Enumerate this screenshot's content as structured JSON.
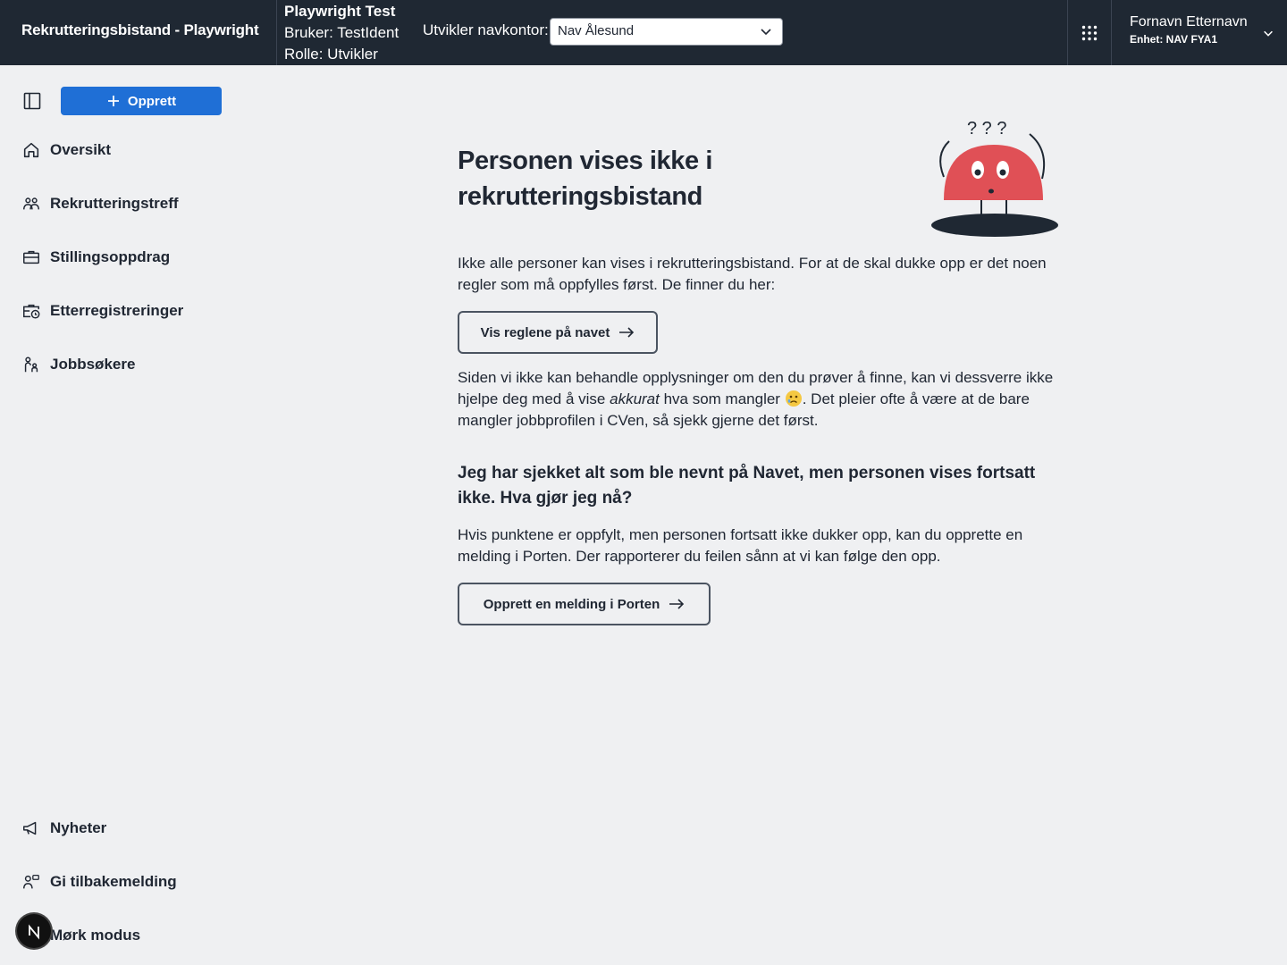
{
  "header": {
    "brand": "Rekrutteringsbistand - Playwright",
    "playwright_title": "Playwright Test",
    "user_line": "Bruker: TestIdent",
    "role_line": "Rolle: Utvikler",
    "kontor_label": "Utvikler navkontor:",
    "kontor_value": "Nav Ålesund",
    "user_name": "Fornavn Etternavn",
    "user_unit": "Enhet: NAV FYA1"
  },
  "sidebar": {
    "create_label": "Opprett",
    "items": [
      {
        "label": "Oversikt",
        "icon": "house-icon"
      },
      {
        "label": "Rekrutteringstreff",
        "icon": "people-icon"
      },
      {
        "label": "Stillingsoppdrag",
        "icon": "briefcase-icon"
      },
      {
        "label": "Etterregistreringer",
        "icon": "briefcase-clock-icon"
      },
      {
        "label": "Jobbsøkere",
        "icon": "person-group-icon"
      }
    ],
    "bottom_items": [
      {
        "label": "Nyheter",
        "icon": "megaphone-icon"
      },
      {
        "label": "Gi tilbakemelding",
        "icon": "feedback-icon"
      },
      {
        "label": "Mørk modus",
        "icon": "moon-icon"
      }
    ]
  },
  "main": {
    "title": "Personen vises ikke i rekrutteringsbistand",
    "intro": "Ikke alle personer kan vises i rekrutteringsbistand. For at de skal dukke opp er det noen regler som må oppfylles først. De finner du her:",
    "rules_button": "Vis reglene på navet",
    "explain_pre": "Siden vi ikke kan behandle opplysninger om den du prøver å finne, kan vi dessverre ikke hjelpe deg med å vise ",
    "explain_em": "akkurat",
    "explain_post": " hva som mangler",
    "explain_tail": ". Det pleier ofte å være at de bare mangler jobbprofilen i CVen, så sjekk gjerne det først.",
    "subheading": "Jeg har sjekket alt som ble nevnt på Navet, men personen vises fortsatt ikke. Hva gjør jeg nå?",
    "porten_text": "Hvis punktene er oppfylt, men personen fortsatt ikke dukker opp, kan du opprette en melding i Porten. Der rapporterer du feilen sånn at vi kan følge den opp.",
    "porten_button": "Opprett en melding i Porten",
    "illustration_marks": "? ? ?"
  },
  "colors": {
    "header_bg": "#1f2833",
    "accent": "#1f6fd6",
    "page_bg": "#eff0f2",
    "illustration_red": "#e05056"
  }
}
